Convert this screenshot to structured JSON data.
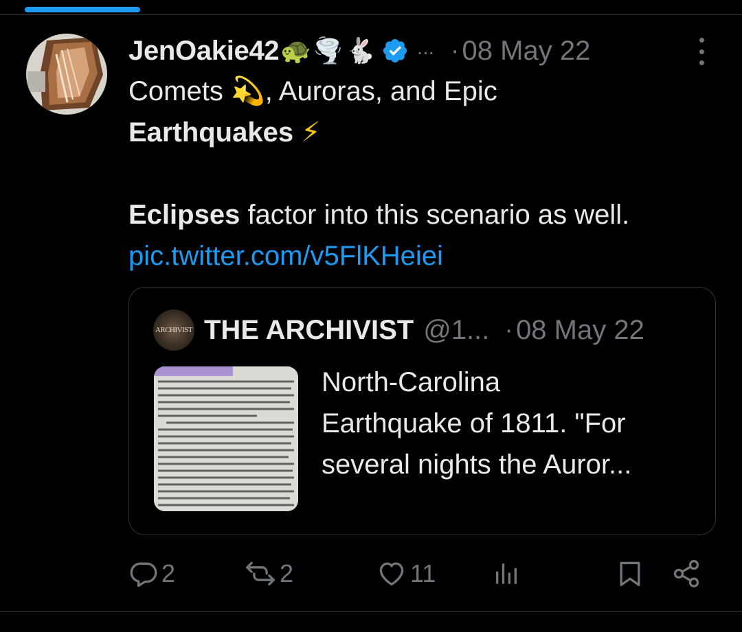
{
  "tweet": {
    "display_name": "JenOakie42",
    "name_emojis": [
      "🐢",
      "🌪️",
      "🐇"
    ],
    "more_indicator": "...",
    "separator": "·",
    "date": "08 May 22",
    "body": {
      "line1_prefix": "Comets ",
      "line1_emoji": "💫",
      "line1_suffix": ", Auroras, and Epic",
      "line2_bold": "Earthquakes",
      "line2_emoji": "⚡",
      "line3_bold": "Eclipses",
      "line3_rest": " factor into this scenario as well.",
      "link": "pic.twitter.com/v5FlKHeiei"
    }
  },
  "quoted_tweet": {
    "avatar_text": "ARCHIVIST",
    "display_name": "THE ARCHIVIST",
    "handle": "@1...",
    "separator": "·",
    "date": "08 May 22",
    "text_lines": [
      "North-Carolina",
      "Earthquake of 1811. \"For",
      "several nights the Auror..."
    ]
  },
  "actions": {
    "replies": "2",
    "retweets": "2",
    "likes": "11"
  },
  "colors": {
    "background": "#000000",
    "text": "#e7e9ea",
    "muted": "#71767b",
    "accent": "#1d9bf0",
    "border": "#2f3336"
  },
  "icons": [
    "verified-badge-icon",
    "more-vertical-icon",
    "reply-icon",
    "retweet-icon",
    "like-icon",
    "views-icon",
    "bookmark-icon",
    "share-icon"
  ]
}
